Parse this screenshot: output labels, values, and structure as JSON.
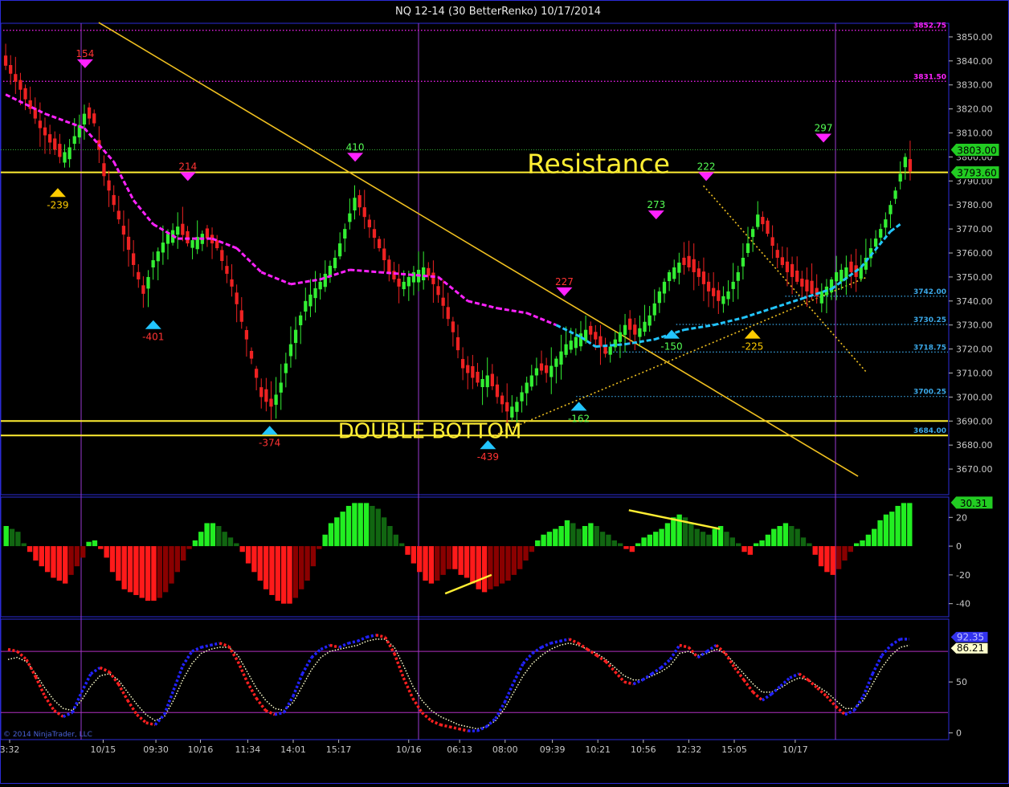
{
  "window": {
    "title": "NQ 12-14 (30 BetterRenko)  10/17/2014"
  },
  "colors": {
    "bg": "#000000",
    "frame": "#2b2bd6",
    "up": "#33ee33",
    "down": "#ee2222",
    "yellow": "#ffee33",
    "magenta": "#ff22ff",
    "cyan": "#22c5ff",
    "pivot_high": "#ff22ff",
    "pivot_low": "#22c5ff",
    "pivot_gold": "#ffcc00",
    "level_line": "#3aa8e8",
    "osc_blue": "#2222ff",
    "osc_red": "#ff2020",
    "osc_white": "#ffffcc",
    "hist_bright_up": "#22ee22",
    "hist_dark_up": "#116611",
    "hist_bright_down": "#ff1a1a",
    "hist_dark_down": "#8a0000"
  },
  "chart_data": [
    {
      "type": "candlestick",
      "panel": "price",
      "ylim": [
        3660,
        3855
      ],
      "yticks": [
        3670,
        3680,
        3690,
        3700,
        3710,
        3720,
        3730,
        3740,
        3750,
        3760,
        3770,
        3780,
        3790,
        3800,
        3810,
        3820,
        3830,
        3840,
        3850
      ],
      "price_badges": [
        {
          "value": 3803.0,
          "label": "3803.00"
        },
        {
          "value": 3793.6,
          "label": "3793.60"
        }
      ],
      "levels": [
        {
          "value": 3852.75,
          "label": "3852.75",
          "style": "magenta-dotted",
          "from": 0.0
        },
        {
          "value": 3831.5,
          "label": "3831.50",
          "style": "magenta-dotted",
          "from": 0.0
        },
        {
          "value": 3742.0,
          "label": "3742.00",
          "style": "blue-dotted",
          "from": 0.86
        },
        {
          "value": 3730.25,
          "label": "3730.25",
          "style": "blue-dotted",
          "from": 0.74
        },
        {
          "value": 3718.75,
          "label": "3718.75",
          "style": "blue-dotted",
          "from": 0.66
        },
        {
          "value": 3700.25,
          "label": "3700.25",
          "style": "blue-dotted",
          "from": 0.63
        },
        {
          "value": 3684.0,
          "label": "3684.00",
          "style": "blue-dotted",
          "from": 0.53
        }
      ],
      "horizontal_lines": [
        {
          "value": 3793.6,
          "color": "yellow"
        },
        {
          "value": 3690.0,
          "color": "yellow"
        },
        {
          "value": 3684.0,
          "color": "yellow"
        },
        {
          "value": 3803.0,
          "color": "green-dotted"
        }
      ],
      "annotations": [
        {
          "text": "Resistance",
          "value": 3797
        },
        {
          "text": "DOUBLE BOTTOM",
          "value": 3686
        }
      ],
      "trendlines": [
        {
          "from": [
            0.105,
            3856
          ],
          "to": [
            0.94,
            3667
          ],
          "style": "solid"
        },
        {
          "from": [
            0.54,
            3684
          ],
          "to": [
            0.95,
            3750
          ],
          "style": "dotted"
        },
        {
          "from": [
            0.77,
            3788
          ],
          "to": [
            0.95,
            3710
          ],
          "style": "dotted"
        }
      ],
      "pivots": [
        {
          "x": 0.06,
          "value": 3786,
          "label": "-239",
          "kind": "low",
          "color": "gold"
        },
        {
          "x": 0.09,
          "value": 3838,
          "label": "154",
          "kind": "high",
          "color": "magenta"
        },
        {
          "x": 0.165,
          "value": 3731,
          "label": "-401",
          "kind": "low",
          "color": "cyan"
        },
        {
          "x": 0.203,
          "value": 3791,
          "label": "214",
          "kind": "high",
          "color": "magenta"
        },
        {
          "x": 0.293,
          "value": 3687,
          "label": "-374",
          "kind": "low",
          "color": "cyan"
        },
        {
          "x": 0.387,
          "value": 3799,
          "label": "410",
          "kind": "high",
          "color": "magenta"
        },
        {
          "x": 0.533,
          "value": 3681,
          "label": "-439",
          "kind": "low",
          "color": "cyan"
        },
        {
          "x": 0.617,
          "value": 3743,
          "label": "227",
          "kind": "high",
          "color": "magenta"
        },
        {
          "x": 0.633,
          "value": 3697,
          "label": "-162",
          "kind": "low",
          "color": "cyan"
        },
        {
          "x": 0.718,
          "value": 3775,
          "label": "273",
          "kind": "high",
          "color": "magenta"
        },
        {
          "x": 0.735,
          "value": 3727,
          "label": "-150",
          "kind": "low",
          "color": "cyan"
        },
        {
          "x": 0.773,
          "value": 3791,
          "label": "222",
          "kind": "high",
          "color": "magenta"
        },
        {
          "x": 0.824,
          "value": 3727,
          "label": "-225",
          "kind": "low",
          "color": "gold"
        },
        {
          "x": 0.902,
          "value": 3807,
          "label": "297",
          "kind": "high",
          "color": "magenta"
        }
      ],
      "series": [
        {
          "name": "close",
          "values": []
        }
      ],
      "close_path": [
        [
          0,
          3838
        ],
        [
          3,
          3828
        ],
        [
          7,
          3812
        ],
        [
          11,
          3800
        ],
        [
          13,
          3804
        ],
        [
          16,
          3818
        ],
        [
          18,
          3814
        ],
        [
          20,
          3792
        ],
        [
          23,
          3774
        ],
        [
          26,
          3755
        ],
        [
          28,
          3743
        ],
        [
          30,
          3757
        ],
        [
          33,
          3768
        ],
        [
          35,
          3771
        ],
        [
          37,
          3764
        ],
        [
          40,
          3768
        ],
        [
          43,
          3762
        ],
        [
          46,
          3746
        ],
        [
          49,
          3724
        ],
        [
          52,
          3700
        ],
        [
          54,
          3696
        ],
        [
          56,
          3706
        ],
        [
          58,
          3722
        ],
        [
          61,
          3740
        ],
        [
          64,
          3748
        ],
        [
          67,
          3758
        ],
        [
          69,
          3770
        ],
        [
          71,
          3783
        ],
        [
          73,
          3775
        ],
        [
          76,
          3762
        ],
        [
          78,
          3752
        ],
        [
          80,
          3746
        ],
        [
          83,
          3752
        ],
        [
          85,
          3754
        ],
        [
          87,
          3747
        ],
        [
          89,
          3738
        ],
        [
          91,
          3727
        ],
        [
          93,
          3712
        ],
        [
          96,
          3706
        ],
        [
          98,
          3709
        ],
        [
          100,
          3700
        ],
        [
          102,
          3694
        ],
        [
          104,
          3698
        ],
        [
          106,
          3706
        ],
        [
          108,
          3712
        ],
        [
          110,
          3710
        ],
        [
          112,
          3716
        ],
        [
          114,
          3722
        ],
        [
          116,
          3725
        ],
        [
          118,
          3728
        ],
        [
          120,
          3724
        ],
        [
          122,
          3718
        ],
        [
          124,
          3724
        ],
        [
          126,
          3730
        ],
        [
          128,
          3726
        ],
        [
          131,
          3734
        ],
        [
          133,
          3744
        ],
        [
          135,
          3752
        ],
        [
          137,
          3756
        ],
        [
          139,
          3754
        ],
        [
          141,
          3750
        ],
        [
          143,
          3744
        ],
        [
          145,
          3740
        ],
        [
          147,
          3744
        ],
        [
          149,
          3752
        ],
        [
          151,
          3764
        ],
        [
          153,
          3776
        ],
        [
          155,
          3768
        ],
        [
          157,
          3758
        ],
        [
          159,
          3752
        ],
        [
          161,
          3748
        ],
        [
          163,
          3744
        ],
        [
          165,
          3742
        ],
        [
          167,
          3746
        ],
        [
          169,
          3752
        ],
        [
          171,
          3754
        ],
        [
          173,
          3750
        ],
        [
          175,
          3758
        ],
        [
          177,
          3766
        ],
        [
          179,
          3774
        ],
        [
          181,
          3786
        ],
        [
          183,
          3800
        ],
        [
          184,
          3794
        ]
      ],
      "bars_count": 185,
      "vma_path": [
        [
          0,
          3826
        ],
        [
          8,
          3818
        ],
        [
          16,
          3812
        ],
        [
          22,
          3798
        ],
        [
          26,
          3782
        ],
        [
          30,
          3772
        ],
        [
          35,
          3766
        ],
        [
          42,
          3766
        ],
        [
          47,
          3762
        ],
        [
          52,
          3752
        ],
        [
          58,
          3747
        ],
        [
          64,
          3749
        ],
        [
          70,
          3753
        ],
        [
          76,
          3752
        ],
        [
          82,
          3751
        ],
        [
          88,
          3750
        ],
        [
          94,
          3740
        ],
        [
          100,
          3737
        ],
        [
          106,
          3735
        ],
        [
          112,
          3730
        ],
        [
          117,
          3725
        ],
        [
          120,
          3721
        ],
        [
          126,
          3722
        ],
        [
          132,
          3724
        ],
        [
          138,
          3728
        ],
        [
          144,
          3730
        ],
        [
          150,
          3733
        ],
        [
          156,
          3737
        ],
        [
          162,
          3741
        ],
        [
          168,
          3745
        ],
        [
          174,
          3754
        ],
        [
          180,
          3769
        ],
        [
          182,
          3772
        ]
      ],
      "x_ticks": [
        {
          "label": "3:32",
          "x": 0.0
        },
        {
          "label": "10/15",
          "x": 0.094
        },
        {
          "label": "09:30",
          "x": 0.152
        },
        {
          "label": "10/16",
          "x": 0.201
        },
        {
          "label": "11:34",
          "x": 0.253
        },
        {
          "label": "14:01",
          "x": 0.303
        },
        {
          "label": "15:17",
          "x": 0.353
        },
        {
          "label": "10/16",
          "x": 0.43
        },
        {
          "label": "06:13",
          "x": 0.486
        },
        {
          "label": "08:00",
          "x": 0.536
        },
        {
          "label": "09:39",
          "x": 0.588
        },
        {
          "label": "10:21",
          "x": 0.638
        },
        {
          "label": "10:56",
          "x": 0.688
        },
        {
          "label": "12:32",
          "x": 0.738
        },
        {
          "label": "15:05",
          "x": 0.788
        },
        {
          "label": "10/17",
          "x": 0.855
        }
      ]
    },
    {
      "type": "bar",
      "panel": "histogram",
      "ylim": [
        -48,
        33
      ],
      "yticks": [
        20,
        0,
        -20,
        -40
      ],
      "badge": {
        "value": 30.31,
        "label": "30.31"
      },
      "values": [
        14,
        12,
        10,
        2,
        -4,
        -10,
        -14,
        -18,
        -22,
        -24,
        -26,
        -20,
        -14,
        -8,
        3,
        4,
        -2,
        -8,
        -18,
        -24,
        -30,
        -32,
        -34,
        -36,
        -38,
        -38,
        -36,
        -32,
        -26,
        -18,
        -10,
        -2,
        4,
        10,
        16,
        16,
        14,
        10,
        6,
        2,
        -4,
        -12,
        -18,
        -24,
        -30,
        -34,
        -38,
        -40,
        -40,
        -36,
        -30,
        -24,
        -14,
        -2,
        8,
        16,
        20,
        24,
        28,
        30,
        30,
        30,
        28,
        26,
        20,
        14,
        8,
        2,
        -6,
        -12,
        -18,
        -24,
        -26,
        -24,
        -20,
        -16,
        -16,
        -20,
        -22,
        -26,
        -30,
        -32,
        -30,
        -28,
        -26,
        -24,
        -20,
        -16,
        -10,
        -4,
        4,
        8,
        10,
        12,
        14,
        18,
        16,
        12,
        14,
        16,
        14,
        10,
        8,
        4,
        2,
        -2,
        -4,
        2,
        6,
        8,
        10,
        12,
        16,
        20,
        22,
        20,
        16,
        12,
        10,
        8,
        12,
        14,
        10,
        6,
        2,
        -4,
        -6,
        2,
        4,
        8,
        12,
        14,
        16,
        14,
        12,
        6,
        2,
        -6,
        -14,
        -18,
        -20,
        -16,
        -10,
        -4,
        2,
        4,
        8,
        12,
        18,
        22,
        24,
        28,
        30,
        30
      ],
      "trendlines": [
        {
          "from": [
            0.486,
            -33
          ],
          "to": [
            0.537,
            -20
          ]
        },
        {
          "from": [
            0.688,
            25
          ],
          "to": [
            0.788,
            12
          ]
        }
      ]
    },
    {
      "type": "line",
      "panel": "oscillator",
      "ylim": [
        -5,
        110
      ],
      "yticks": [
        50,
        0
      ],
      "badges": [
        {
          "value": 92.35,
          "label": "92.35"
        },
        {
          "value": 86.21,
          "label": "86.21"
        }
      ],
      "levels": [
        80,
        20
      ],
      "series": [
        {
          "name": "fast",
          "values": [
            82,
            80,
            72,
            55,
            36,
            22,
            16,
            20,
            40,
            58,
            64,
            60,
            48,
            32,
            18,
            10,
            8,
            18,
            42,
            66,
            80,
            84,
            86,
            88,
            85,
            70,
            50,
            34,
            22,
            18,
            20,
            36,
            58,
            74,
            82,
            86,
            84,
            88,
            90,
            94,
            96,
            94,
            78,
            54,
            34,
            20,
            12,
            8,
            6,
            4,
            2,
            2,
            6,
            14,
            30,
            50,
            68,
            78,
            84,
            88,
            90,
            92,
            88,
            82,
            76,
            70,
            60,
            50,
            48,
            52,
            58,
            64,
            72,
            86,
            84,
            74,
            80,
            86,
            78,
            64,
            52,
            40,
            32,
            38,
            46,
            54,
            58,
            52,
            44,
            36,
            26,
            18,
            22,
            36,
            58,
            76,
            86,
            92,
            92
          ]
        },
        {
          "name": "slow",
          "values": [
            72,
            74,
            70,
            58,
            44,
            32,
            24,
            22,
            32,
            46,
            56,
            58,
            52,
            40,
            28,
            18,
            12,
            16,
            32,
            52,
            68,
            78,
            82,
            84,
            84,
            76,
            60,
            44,
            32,
            24,
            22,
            30,
            46,
            62,
            74,
            80,
            82,
            84,
            86,
            90,
            92,
            92,
            84,
            66,
            46,
            32,
            22,
            16,
            12,
            8,
            6,
            4,
            6,
            12,
            24,
            40,
            56,
            68,
            76,
            82,
            86,
            88,
            86,
            82,
            78,
            72,
            64,
            56,
            52,
            52,
            56,
            60,
            66,
            78,
            80,
            76,
            78,
            82,
            78,
            68,
            58,
            48,
            40,
            40,
            44,
            50,
            54,
            52,
            46,
            40,
            32,
            24,
            24,
            32,
            48,
            64,
            76,
            84,
            86
          ]
        }
      ]
    }
  ],
  "copyright": "© 2014 NinjaTrader, LLC"
}
